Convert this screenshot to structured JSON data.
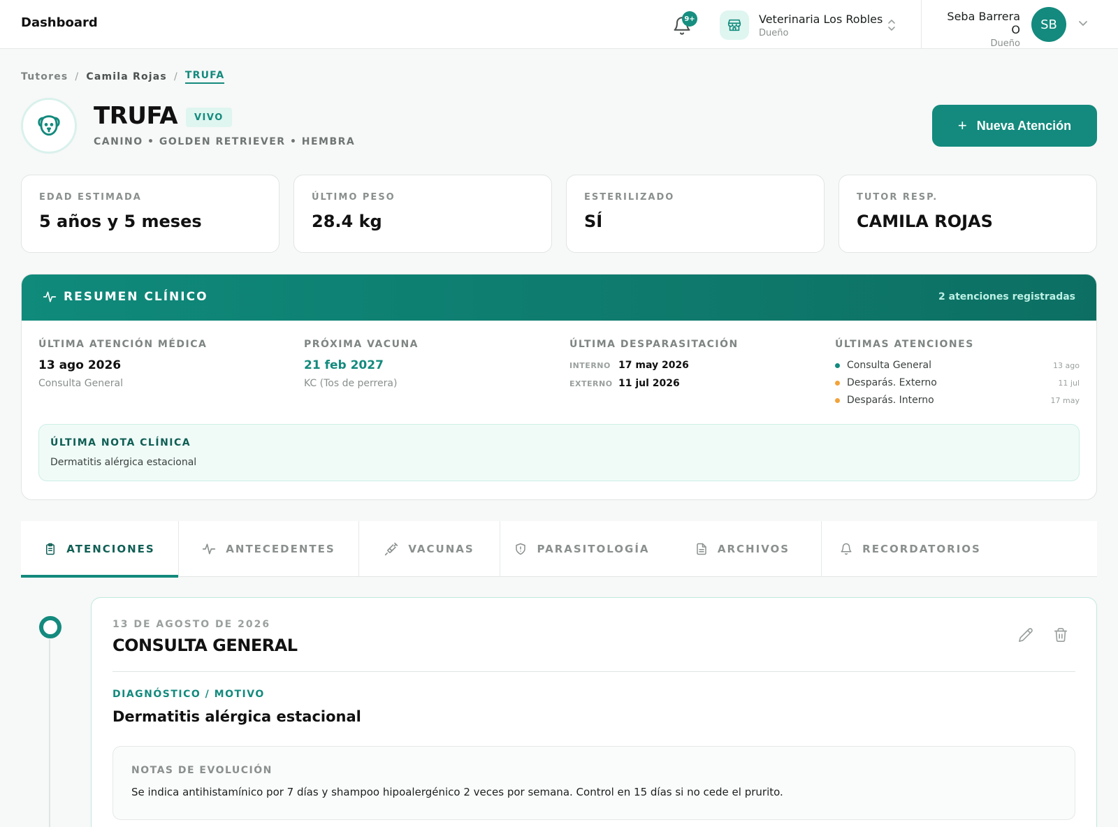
{
  "topbar": {
    "title": "Dashboard",
    "notifications_badge": "9+",
    "clinic": {
      "name": "Veterinaria Los Robles",
      "role": "Dueño"
    },
    "user": {
      "name": "Seba Barrera O",
      "role": "Dueño",
      "initials": "SB"
    }
  },
  "breadcrumb": {
    "items": [
      "Tutores",
      "Camila Rojas"
    ],
    "current": "TRUFA"
  },
  "patient": {
    "name": "TRUFA",
    "status": "VIVO",
    "subtitle": "CANINO • GOLDEN RETRIEVER • HEMBRA",
    "new_button": "Nueva Atención"
  },
  "stats": [
    {
      "label": "EDAD ESTIMADA",
      "value": "5 años y 5 meses"
    },
    {
      "label": "ÚLTIMO PESO",
      "value": "28.4 kg"
    },
    {
      "label": "ESTERILIZADO",
      "value": "SÍ"
    },
    {
      "label": "TUTOR RESP.",
      "value": "CAMILA ROJAS"
    }
  ],
  "resumen": {
    "title": "RESUMEN CLÍNICO",
    "count": "2 atenciones registradas",
    "ultima_atencion": {
      "label": "ÚLTIMA ATENCIÓN MÉDICA",
      "date": "13 ago 2026",
      "detail": "Consulta General"
    },
    "proxima_vacuna": {
      "label": "PRÓXIMA VACUNA",
      "date": "21 feb 2027",
      "detail": "KC (Tos de perrera)"
    },
    "desparasitacion": {
      "label": "ÚLTIMA DESPARASITACIÓN",
      "rows": [
        {
          "key": "INTERNO",
          "value": "17 may 2026"
        },
        {
          "key": "EXTERNO",
          "value": "11 jul 2026"
        }
      ]
    },
    "ultimas_atenciones": {
      "label": "ÚLTIMAS ATENCIONES",
      "items": [
        {
          "name": "Consulta General",
          "date": "13 ago",
          "color": "#138a7d"
        },
        {
          "name": "Desparás. Externo",
          "date": "11 jul",
          "color": "#f2a33a"
        },
        {
          "name": "Desparás. Interno",
          "date": "17 may",
          "color": "#f2a33a"
        }
      ]
    },
    "nota": {
      "label": "ÚLTIMA NOTA CLÍNICA",
      "text": "Dermatitis alérgica estacional"
    }
  },
  "tabs": [
    {
      "label": "ATENCIONES",
      "icon": "clipboard-icon"
    },
    {
      "label": "ANTECEDENTES",
      "icon": "activity-icon"
    },
    {
      "label": "VACUNAS",
      "icon": "syringe-icon"
    },
    {
      "label": "PARASITOLOGÍA",
      "icon": "shield-icon"
    },
    {
      "label": "ARCHIVOS",
      "icon": "file-icon"
    },
    {
      "label": "RECORDATORIOS",
      "icon": "bell-icon"
    }
  ],
  "atencion": {
    "date": "13 DE AGOSTO DE 2026",
    "title": "CONSULTA GENERAL",
    "dx_label": "DIAGNÓSTICO / MOTIVO",
    "dx": "Dermatitis alérgica estacional",
    "notes_label": "NOTAS DE EVOLUCIÓN",
    "notes": "Se indica antihistamínico por 7 días y shampoo hipoalergénico 2 veces por semana. Control en 15 días si no cede el prurito."
  },
  "colors": {
    "accent": "#138a7d",
    "accent_dark": "#0d6f63",
    "warning": "#f2a33a"
  }
}
